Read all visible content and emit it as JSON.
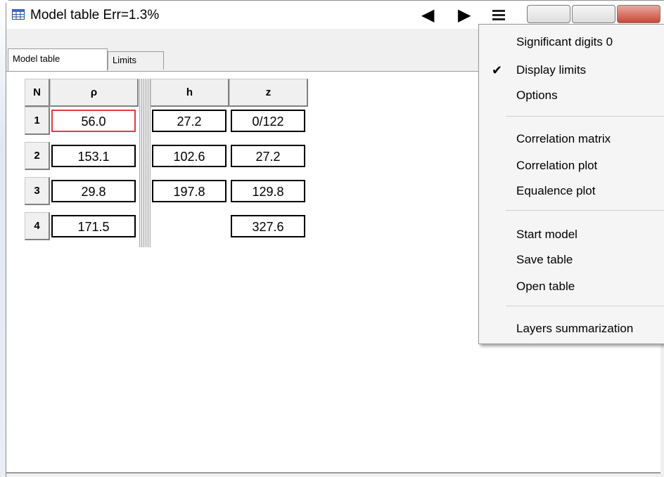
{
  "window": {
    "title": "Model table Err=1.3%",
    "icons": {
      "app": "table-icon",
      "prev": "triangle-left-icon",
      "next": "triangle-right-icon",
      "menu": "hamburger-menu-icon"
    },
    "prev_glyph": "◀",
    "next_glyph": "▶"
  },
  "tabs": [
    {
      "label": "Model table",
      "active": true
    },
    {
      "label": "Limits",
      "active": false
    }
  ],
  "table": {
    "headers": [
      "N",
      "ρ",
      "h",
      "z"
    ],
    "rows": [
      {
        "n": "1",
        "rho": "56.0",
        "h": "27.2",
        "z": "0/122"
      },
      {
        "n": "2",
        "rho": "153.1",
        "h": "102.6",
        "z": "27.2"
      },
      {
        "n": "3",
        "rho": "29.8",
        "h": "197.8",
        "z": "129.8"
      },
      {
        "n": "4",
        "rho": "171.5",
        "h": "",
        "z": "327.6"
      }
    ],
    "selected_cell": "row1-rho",
    "selected_color": "#e53a3a"
  },
  "context_menu": {
    "items": [
      {
        "label": "Significant digits 0",
        "checked": false
      },
      {
        "label": "Display limits",
        "checked": true,
        "check_glyph": "✔"
      },
      {
        "label": "Options",
        "checked": false
      },
      {
        "label": "Correlation matrix",
        "checked": false
      },
      {
        "label": "Correlation plot",
        "checked": false
      },
      {
        "label": "Equalence plot",
        "checked": false
      },
      {
        "label": "Start model",
        "checked": false
      },
      {
        "label": "Save table",
        "checked": false
      },
      {
        "label": "Open table",
        "checked": false
      },
      {
        "label": "Layers summarization",
        "checked": false
      }
    ]
  }
}
